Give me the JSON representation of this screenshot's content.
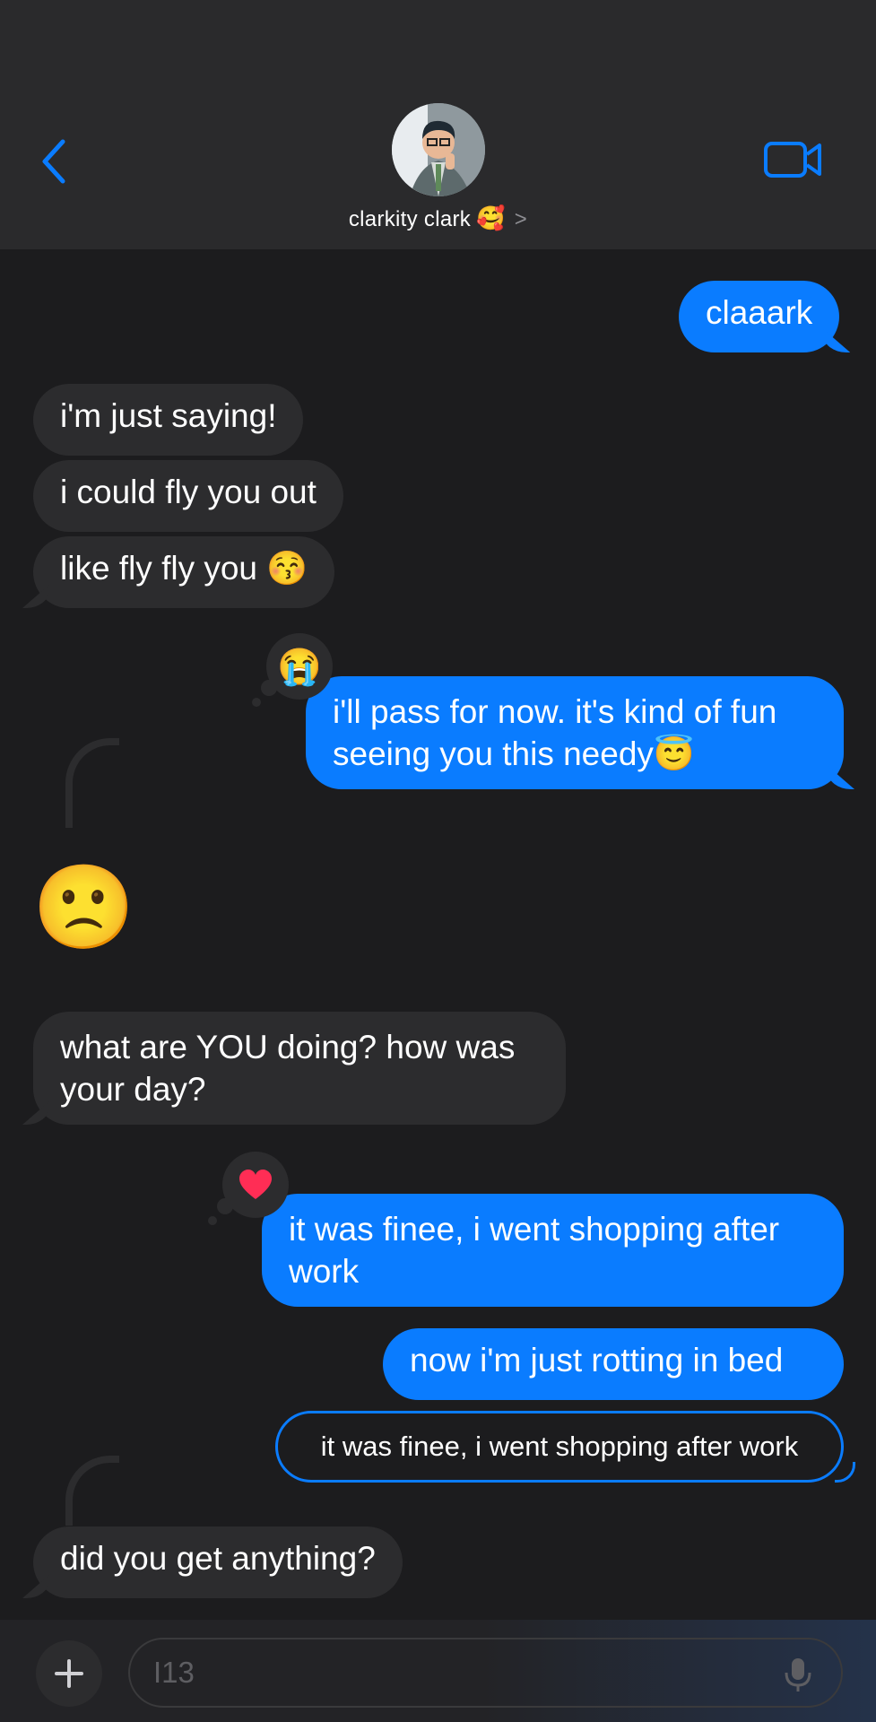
{
  "header": {
    "contact_name": "clarkity clark",
    "contact_emoji": "🥰",
    "chevron": ">",
    "back_icon": "chevron-left-icon",
    "video_icon": "video-camera-icon"
  },
  "messages": [
    {
      "id": "m1",
      "side": "out",
      "text": "claaark"
    },
    {
      "id": "m2",
      "side": "in",
      "text": "i'm just saying!"
    },
    {
      "id": "m3",
      "side": "in",
      "text": "i could fly you out"
    },
    {
      "id": "m4",
      "side": "in",
      "text": "like fly fly you 😚"
    },
    {
      "id": "m5",
      "side": "out",
      "line1": "i'll pass for now. it's kind of fun",
      "line2": "seeing you this needy😇",
      "reaction": "😭"
    },
    {
      "id": "m6",
      "side": "in",
      "emoji": "🙁"
    },
    {
      "id": "m7",
      "side": "in",
      "line1": "what are YOU doing? how was",
      "line2": "your day?"
    },
    {
      "id": "m8",
      "side": "out",
      "line1": "it was finee, i went shopping after",
      "line2": "work",
      "reaction": "❤️"
    },
    {
      "id": "m9",
      "side": "out",
      "text": "now i'm just rotting in bed"
    },
    {
      "id": "m10",
      "side": "out",
      "quoted": "it was finee, i went shopping after work"
    },
    {
      "id": "m11",
      "side": "in",
      "text": "did you get anything?"
    }
  ],
  "composer": {
    "plus_icon": "plus-icon",
    "value": "I13",
    "mic_icon": "microphone-icon"
  },
  "colors": {
    "outgoing": "#0a7cff",
    "incoming": "#2c2c2e",
    "background": "#1c1c1e",
    "accent": "#0a7cff"
  }
}
